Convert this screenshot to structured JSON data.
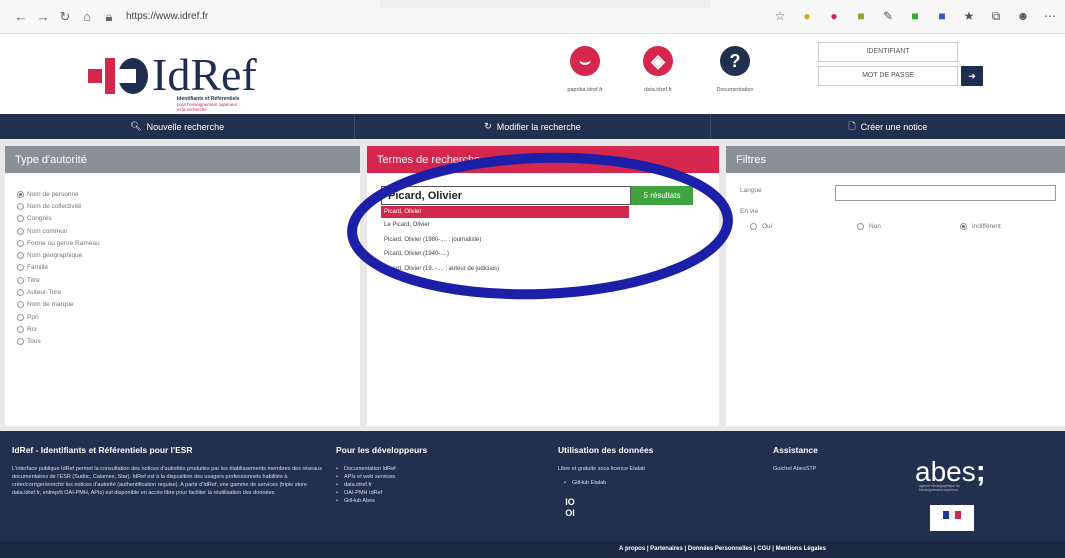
{
  "browser": {
    "url": "https://www.idref.fr"
  },
  "header": {
    "logo": {
      "prefix": "Id",
      "suffix": "Ref",
      "tagline_1": "Identifiants et Référentiels",
      "tagline_2": "pour l'enseignement supérieur",
      "tagline_3": "et la recherche"
    },
    "links": [
      {
        "label": "paprika.idref.fr",
        "icon": "paprika-icon",
        "color": "#d5264d"
      },
      {
        "label": "data.idref.fr",
        "icon": "data-icon",
        "color": "#d5264d"
      },
      {
        "label": "Documentation",
        "icon": "help-icon",
        "color": "#22304f"
      }
    ],
    "login": {
      "identifiant": "IDENTIFIANT",
      "password": "MOT DE PASSE"
    }
  },
  "toolbar": {
    "new_search": "Nouvelle recherche",
    "modify_search": "Modifier la recherche",
    "create_notice": "Créer une notice"
  },
  "authority": {
    "title": "Type d'autorité",
    "types": [
      "Nom de personne",
      "Nom de collectivité",
      "Congrès",
      "Nom commun",
      "Forme ou genre Rameau",
      "Nom géographique",
      "Famille",
      "Titre",
      "Auteur-Titre",
      "Nom de marque",
      "Ppn",
      "Rcr",
      "Tous"
    ],
    "selected": "Nom de personne"
  },
  "search": {
    "title": "Termes de recherche",
    "query": "Picard, Olivier",
    "results": "5 résultats",
    "suggestions": [
      "Picard, Olivier",
      "Le Picard, Olivier",
      "Picard, Olivier (1980-.... ; journaliste)",
      "Picard, Olivier (1940-....)",
      "Picard, Olivier (19..-.... ; auteur de judiciais)"
    ]
  },
  "filters": {
    "title": "Filtres",
    "langue": "Langue",
    "envie": "En vie",
    "options": [
      "Oui",
      "Non",
      "Indifférent"
    ],
    "selected": "Indifférent"
  },
  "footer": {
    "about_title": "IdRef - Identifiants et Référentiels pour l'ESR",
    "about_text": "L'interface publique IdRef permet la consultation des notices d'autorités produites par les établissements membres des réseaux documentaires de l'ESR (Sudoc, Calames, Star). IdRef est à la disposition des usagers professionnels habilités à créer/corriger/enrichir les notices d'autorité (authentification requise). A partir d'IdRef, une gamme de services (triple store data.idref.fr, entrepôt OAI-PMH, APIs) est disponible en accès libre pour faciliter la réutilisation des données.",
    "dev_title": "Pour les développeurs",
    "dev_links": [
      "Documentation IdRef",
      "APIs et web services",
      "data.idref.fr",
      "OAI-PMH IdRef",
      "GitHub Abes"
    ],
    "usage_title": "Utilisation des données",
    "usage_text": "Libre et gratuite sous licence Etalab",
    "usage_links": [
      "GitHub Etalab"
    ],
    "assist_title": "Assistance",
    "assist_text": "Guichet AbesSTP",
    "abes": "abes",
    "abes_sub": "agence bibliographique de l'enseignement supérieur",
    "oi": "IO\nOI",
    "bottom": "A propos | Partenaires | Données Personnelles | CGU | Mentions Légales"
  }
}
